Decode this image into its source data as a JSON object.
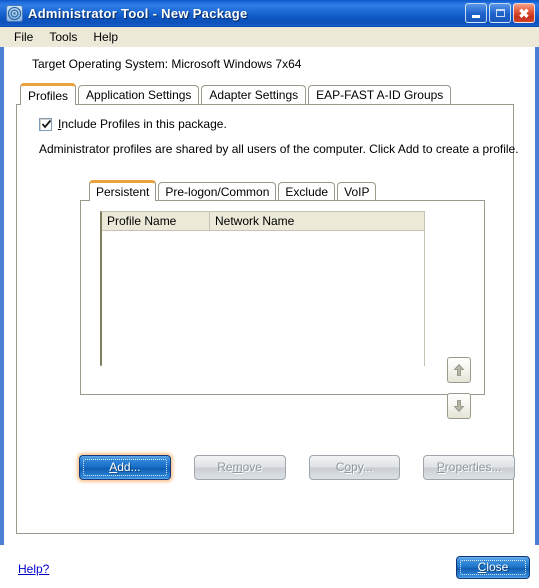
{
  "window": {
    "title": "Administrator Tool - New Package",
    "icon": "wireless-signal-icon",
    "controls": {
      "minimize": "minimize-button",
      "maximize": "maximize-button",
      "close": "close-window-button"
    }
  },
  "menubar": {
    "items": [
      {
        "label": "File"
      },
      {
        "label": "Tools"
      },
      {
        "label": "Help"
      }
    ]
  },
  "main": {
    "target_os_label": "Target Operating System: Microsoft Windows 7x64",
    "tabs": [
      {
        "label": "Profiles",
        "active": true
      },
      {
        "label": "Application Settings",
        "active": false
      },
      {
        "label": "Adapter Settings",
        "active": false
      },
      {
        "label": "EAP-FAST A-ID Groups",
        "active": false
      }
    ],
    "include_checkbox": {
      "checked": true,
      "accel": "I",
      "label_rest": "nclude Profiles in this package."
    },
    "description": "Administrator profiles are shared by all users of the computer. Click Add to create a profile.",
    "inner_tabs": [
      {
        "label": "Persistent",
        "active": true
      },
      {
        "label": "Pre-logon/Common",
        "active": false
      },
      {
        "label": "Exclude",
        "active": false
      },
      {
        "label": "VoIP",
        "active": false
      }
    ],
    "list": {
      "columns": [
        "Profile Name",
        "Network Name"
      ],
      "rows": []
    },
    "order_buttons": [
      {
        "name": "move-up-button",
        "icon": "arrow-up-icon"
      },
      {
        "name": "move-down-button",
        "icon": "arrow-down-icon"
      }
    ],
    "actions": [
      {
        "name": "add-button",
        "accel": "A",
        "pre": "",
        "rest": "dd...",
        "state": "default"
      },
      {
        "name": "remove-button",
        "accel": "m",
        "pre": "Re",
        "rest": "ove",
        "state": "disabled"
      },
      {
        "name": "copy-button",
        "accel": "o",
        "pre": "C",
        "rest": "py...",
        "state": "disabled"
      },
      {
        "name": "properties-button",
        "accel": "P",
        "pre": "",
        "rest": "roperties...",
        "state": "disabled"
      }
    ]
  },
  "footer": {
    "help_link": "Help?",
    "close_accel": "C",
    "close_rest": "lose"
  },
  "colors": {
    "title_blue": "#1d6bda",
    "accent_tab_gold": "#e8a33d",
    "button_blue": "#176cc4",
    "focus_glow_orange": "#f6b26b",
    "panel_beige": "#ece9d8",
    "link_blue": "#0000cc"
  }
}
